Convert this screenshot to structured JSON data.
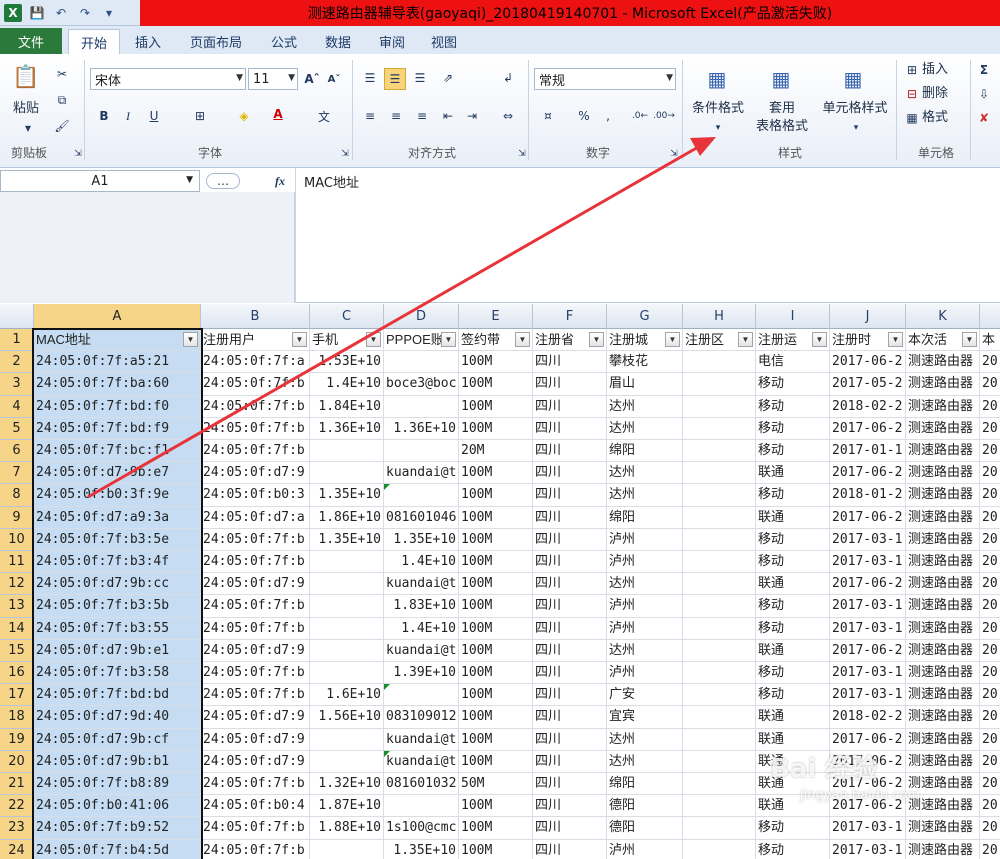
{
  "window": {
    "title": "测速路由器辅导表(gaoyaqi)_20180419140701 - Microsoft Excel(产品激活失败)"
  },
  "tabs": [
    "文件",
    "开始",
    "插入",
    "页面布局",
    "公式",
    "数据",
    "审阅",
    "视图"
  ],
  "ribbon": {
    "clipboard": {
      "paste": "粘贴",
      "group": "剪贴板"
    },
    "font": {
      "name": "宋体",
      "size": "11",
      "group": "字体"
    },
    "alignment": {
      "group": "对齐方式"
    },
    "number": {
      "format": "常规",
      "group": "数字"
    },
    "styles": {
      "conditional": "条件格式",
      "table_line1": "套用",
      "table_line2": "表格格式",
      "cell_styles": "单元格样式",
      "group": "样式"
    },
    "cells": {
      "insert": "插入",
      "delete": "删除",
      "format": "格式",
      "group": "单元格"
    }
  },
  "formula_bar": {
    "name_box": "A1",
    "fx": "fx",
    "content": "MAC地址"
  },
  "columns": [
    "A",
    "B",
    "C",
    "D",
    "E",
    "F",
    "G",
    "H",
    "I",
    "J",
    "K"
  ],
  "headers": [
    "MAC地址",
    "注册用户",
    "手机",
    "PPPOE账",
    "签约带",
    "注册省",
    "注册城",
    "注册区",
    "注册运",
    "注册时",
    "本次活",
    "本"
  ],
  "rows": [
    [
      "24:05:0f:7f:a5:21",
      "24:05:0f:7f:a",
      "1.53E+10",
      "",
      "100M",
      "四川",
      "攀枝花",
      "",
      "电信",
      "2017-06-2",
      "测速路由器",
      "20"
    ],
    [
      "24:05:0f:7f:ba:60",
      "24:05:0f:7f:b",
      "1.4E+10",
      "boce3@boc",
      "100M",
      "四川",
      "眉山",
      "",
      "移动",
      "2017-05-2",
      "测速路由器",
      "20"
    ],
    [
      "24:05:0f:7f:bd:f0",
      "24:05:0f:7f:b",
      "1.84E+10",
      "",
      "100M",
      "四川",
      "达州",
      "",
      "移动",
      "2018-02-2",
      "测速路由器",
      "20"
    ],
    [
      "24:05:0f:7f:bd:f9",
      "24:05:0f:7f:b",
      "1.36E+10",
      "1.36E+10",
      "100M",
      "四川",
      "达州",
      "",
      "移动",
      "2017-06-2",
      "测速路由器",
      "20"
    ],
    [
      "24:05:0f:7f:bc:f1",
      "24:05:0f:7f:b",
      "",
      "",
      "20M",
      "四川",
      "绵阳",
      "",
      "移动",
      "2017-01-1",
      "测速路由器",
      "20"
    ],
    [
      "24:05:0f:d7:9b:e7",
      "24:05:0f:d7:9",
      "",
      "kuandai@t",
      "100M",
      "四川",
      "达州",
      "",
      "联通",
      "2017-06-2",
      "测速路由器",
      "20"
    ],
    [
      "24:05:0f:b0:3f:9e",
      "24:05:0f:b0:3",
      "1.35E+10",
      "",
      "100M",
      "四川",
      "达州",
      "",
      "移动",
      "2018-01-2",
      "测速路由器",
      "20"
    ],
    [
      "24:05:0f:d7:a9:3a",
      "24:05:0f:d7:a",
      "1.86E+10",
      "081601046",
      "100M",
      "四川",
      "绵阳",
      "",
      "联通",
      "2017-06-2",
      "测速路由器",
      "20"
    ],
    [
      "24:05:0f:7f:b3:5e",
      "24:05:0f:7f:b",
      "1.35E+10",
      "1.35E+10",
      "100M",
      "四川",
      "泸州",
      "",
      "移动",
      "2017-03-1",
      "测速路由器",
      "20"
    ],
    [
      "24:05:0f:7f:b3:4f",
      "24:05:0f:7f:b",
      "",
      "1.4E+10",
      "100M",
      "四川",
      "泸州",
      "",
      "移动",
      "2017-03-1",
      "测速路由器",
      "20"
    ],
    [
      "24:05:0f:d7:9b:cc",
      "24:05:0f:d7:9",
      "",
      "kuandai@t",
      "100M",
      "四川",
      "达州",
      "",
      "联通",
      "2017-06-2",
      "测速路由器",
      "20"
    ],
    [
      "24:05:0f:7f:b3:5b",
      "24:05:0f:7f:b",
      "",
      "1.83E+10",
      "100M",
      "四川",
      "泸州",
      "",
      "移动",
      "2017-03-1",
      "测速路由器",
      "20"
    ],
    [
      "24:05:0f:7f:b3:55",
      "24:05:0f:7f:b",
      "",
      "1.4E+10",
      "100M",
      "四川",
      "泸州",
      "",
      "移动",
      "2017-03-1",
      "测速路由器",
      "20"
    ],
    [
      "24:05:0f:d7:9b:e1",
      "24:05:0f:d7:9",
      "",
      "kuandai@t",
      "100M",
      "四川",
      "达州",
      "",
      "联通",
      "2017-06-2",
      "测速路由器",
      "20"
    ],
    [
      "24:05:0f:7f:b3:58",
      "24:05:0f:7f:b",
      "",
      "1.39E+10",
      "100M",
      "四川",
      "泸州",
      "",
      "移动",
      "2017-03-1",
      "测速路由器",
      "20"
    ],
    [
      "24:05:0f:7f:bd:bd",
      "24:05:0f:7f:b",
      "1.6E+10",
      "",
      "100M",
      "四川",
      "广安",
      "",
      "移动",
      "2017-03-1",
      "测速路由器",
      "20"
    ],
    [
      "24:05:0f:d7:9d:40",
      "24:05:0f:d7:9",
      "1.56E+10",
      "083109012",
      "100M",
      "四川",
      "宜宾",
      "",
      "联通",
      "2018-02-2",
      "测速路由器",
      "20"
    ],
    [
      "24:05:0f:d7:9b:cf",
      "24:05:0f:d7:9",
      "",
      "kuandai@t",
      "100M",
      "四川",
      "达州",
      "",
      "联通",
      "2017-06-2",
      "测速路由器",
      "20"
    ],
    [
      "24:05:0f:d7:9b:b1",
      "24:05:0f:d7:9",
      "",
      "kuandai@t",
      "100M",
      "四川",
      "达州",
      "",
      "联通",
      "2017-06-2",
      "测速路由器",
      "20"
    ],
    [
      "24:05:0f:7f:b8:89",
      "24:05:0f:7f:b",
      "1.32E+10",
      "081601032",
      "50M",
      "四川",
      "绵阳",
      "",
      "联通",
      "2017-06-2",
      "测速路由器",
      "20"
    ],
    [
      "24:05:0f:b0:41:06",
      "24:05:0f:b0:4",
      "1.87E+10",
      "",
      "100M",
      "四川",
      "德阳",
      "",
      "联通",
      "2017-06-2",
      "测速路由器",
      "20"
    ],
    [
      "24:05:0f:7f:b9:52",
      "24:05:0f:7f:b",
      "1.88E+10",
      "1s100@cmc",
      "100M",
      "四川",
      "德阳",
      "",
      "移动",
      "2017-03-1",
      "测速路由器",
      "20"
    ],
    [
      "24:05:0f:7f:b4:5d",
      "24:05:0f:7f:b",
      "",
      "1.35E+10",
      "100M",
      "四川",
      "泸州",
      "",
      "移动",
      "2017-03-1",
      "测速路由器",
      "20"
    ]
  ],
  "green_marker_rows": [
    8,
    17,
    20
  ],
  "watermark": {
    "main": "Bai 经验",
    "sub": "jingyan.baidu.com"
  },
  "colors": {
    "accent_green": "#2b7a3c",
    "title_red": "#ee1111",
    "selection_blue": "#c5dcf2",
    "arrow_red": "#e8333a"
  }
}
